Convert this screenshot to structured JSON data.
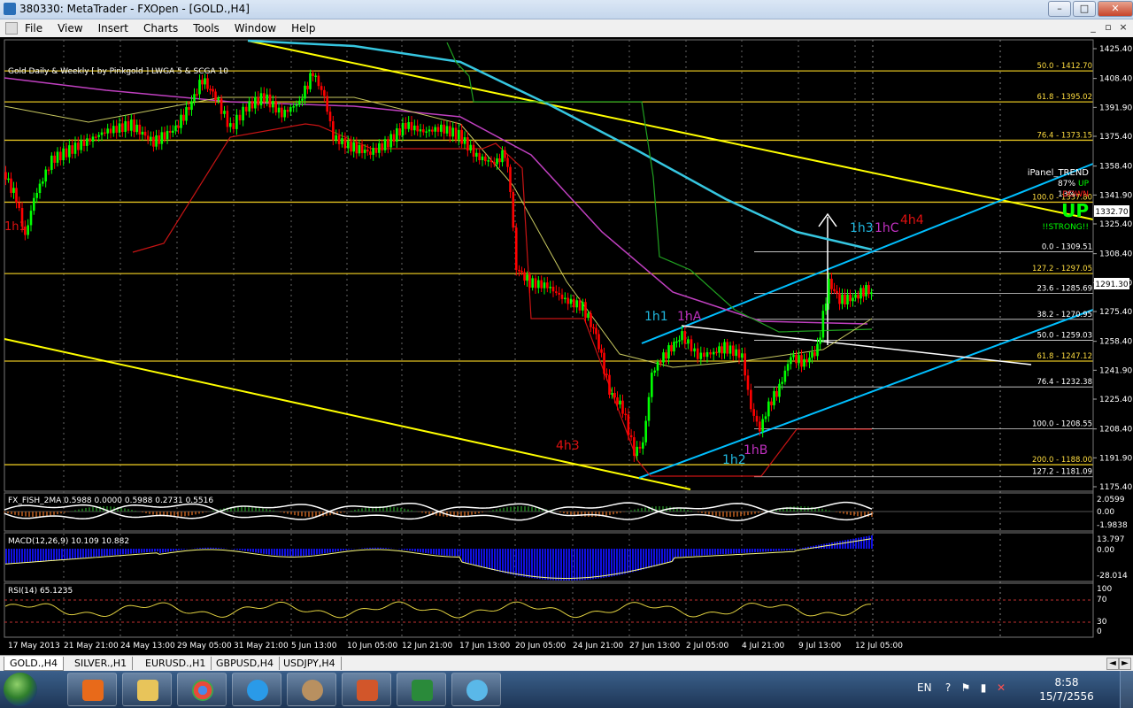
{
  "window": {
    "title": "380330: MetaTrader - FXOpen - [GOLD.,H4]",
    "buttons": {
      "minimize": "–",
      "maximize": "□",
      "close": "✕"
    }
  },
  "menu": {
    "items": [
      "File",
      "View",
      "Insert",
      "Charts",
      "Tools",
      "Window",
      "Help"
    ]
  },
  "mdi": {
    "minimize": "_",
    "restore": "▫",
    "close": "×"
  },
  "chart": {
    "indicator_label": "Gold Daily & Weekly [ by Pinkgold ]  LWGA 5  &  SCGA 10",
    "price_ticks": [
      "1425.40",
      "1408.40",
      "1391.90",
      "1375.40",
      "1358.40",
      "1341.90",
      "1325.40",
      "1308.40",
      "1291.90",
      "1275.40",
      "1258.40",
      "1241.90",
      "1225.40",
      "1208.40",
      "1191.90",
      "1175.40"
    ],
    "current_prices": [
      {
        "label": "1332.70"
      },
      {
        "label": "1291.30"
      }
    ],
    "fib_labels": [
      "50.0 - 1412.70",
      "61.8 - 1395.02",
      "76.4 - 1373.15",
      "100.0 - 1337.80",
      "0.0 - 1309.51",
      "127.2 - 1297.05",
      "23.6 - 1285.69",
      "38.2 - 1270.95",
      "50.0 - 1259.03",
      "61.8 - 1247.12",
      "76.4 - 1232.38",
      "100.0 - 1208.55",
      "200.0 - 1188.00",
      "127.2 - 1181.09"
    ],
    "wave_labels": [
      "1h1",
      "4h3",
      "1h1",
      "1hA",
      "1h2",
      "1hB",
      "1h3",
      "1hC",
      "4h4"
    ],
    "ipanel": {
      "title": "iPanel_TREND",
      "pct1": "87%",
      "dir1": "UP",
      "pct2": "13%",
      "dir2": "DOWN",
      "signal": "UP",
      "strength": "!!STRONG!!"
    },
    "fish": {
      "label": "FX_FISH_2MA 0.5988 0.0000 0.5988 0.2731 0.5516",
      "ticks": [
        "2.0599",
        "0.00",
        "-1.9838"
      ]
    },
    "macd": {
      "label": "MACD(12,26,9) 10.109 10.882",
      "ticks": [
        "13.797",
        "0.00",
        "-28.014"
      ]
    },
    "rsi": {
      "label": "RSI(14) 65.1235",
      "ticks": [
        "100",
        "70",
        "30",
        "0"
      ]
    },
    "date_ticks": [
      "17 May 2013",
      "21 May 21:00",
      "24 May 13:00",
      "29 May 05:00",
      "31 May 21:00",
      "5 Jun 13:00",
      "10 Jun 05:00",
      "12 Jun 21:00",
      "17 Jun 13:00",
      "20 Jun 05:00",
      "24 Jun 21:00",
      "27 Jun 13:00",
      "2 Jul 05:00",
      "4 Jul 21:00",
      "9 Jul 13:00",
      "12 Jul 05:00"
    ]
  },
  "tabs": [
    "GOLD.,H4",
    "SILVER.,H1",
    "EURUSD.,H1",
    "GBPUSD,H4",
    "USDJPY,H4"
  ],
  "tab_nav": {
    "prev": "◄",
    "next": "►"
  },
  "taskbar": {
    "apps": [
      "media-player-icon",
      "folder-icon",
      "chrome-icon",
      "internet-explorer-icon",
      "metatrader-icon",
      "powerpoint-icon",
      "excel-icon",
      "paint-icon"
    ],
    "tray": {
      "lang": "EN",
      "help": "?",
      "flag": "⚑",
      "signal": "▮",
      "volume": "✕",
      "time": "8:58",
      "date": "15/7/2556"
    }
  },
  "colors": {
    "bull_candle": "#00ff00",
    "bear_candle": "#ff0000",
    "trendline": "#ffff00",
    "channel": "#00bfff",
    "fib": "#ffcc00",
    "background": "#000000",
    "grid": "#808080",
    "label_text": "#ffffff"
  }
}
